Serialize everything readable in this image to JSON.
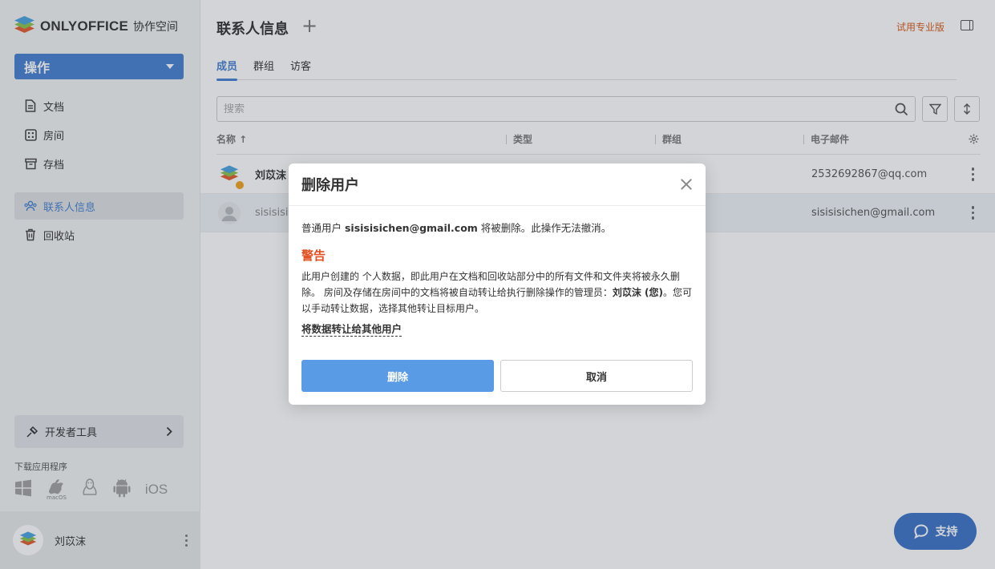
{
  "brand": {
    "name": "ONLYOFFICE",
    "subtitle": "协作空间"
  },
  "sidebar": {
    "actions_label": "操作",
    "items": [
      {
        "label": "文档",
        "icon": "document-icon"
      },
      {
        "label": "房间",
        "icon": "rooms-icon"
      },
      {
        "label": "存档",
        "icon": "archive-icon"
      },
      {
        "label": "联系人信息",
        "icon": "contacts-icon",
        "active": true
      },
      {
        "label": "回收站",
        "icon": "trash-icon"
      }
    ],
    "dev_tools_label": "开发者工具",
    "download_title": "下载应用程序",
    "download_apps": {
      "macos_label": "macOS",
      "ios_label": "iOS"
    },
    "profile_name": "刘苡沫"
  },
  "header": {
    "title": "联系人信息",
    "trial_label": "试用专业版"
  },
  "tabs": [
    {
      "label": "成员",
      "active": true
    },
    {
      "label": "群组"
    },
    {
      "label": "访客"
    }
  ],
  "search": {
    "placeholder": "搜索"
  },
  "table": {
    "columns": [
      "名称 ↑",
      "类型",
      "群组",
      "电子邮件"
    ],
    "rows": [
      {
        "name": "刘苡沫",
        "email": "2532692867@qq.com"
      },
      {
        "name": "sisisisic",
        "email": "sisisisichen@gmail.com"
      }
    ]
  },
  "support_label": "支持",
  "modal": {
    "title": "删除用户",
    "line_prefix": "普通用户 ",
    "line_email": "sisisisichen@gmail.com",
    "line_suffix": " 将被删除。此操作无法撤消。",
    "warning_title": "警告",
    "warning_part1": "此用户创建的 个人数据，即此用户在文档和回收站部分中的所有文件和文件夹将被永久删除。 房间及存储在房间中的文档将被自动转让给执行删除操作的管理员：",
    "warning_admin": "刘苡沫 (您)",
    "warning_part2": "。您可以手动转让数据，选择其他转让目标用户。",
    "transfer_link": "将数据转让给其他用户",
    "delete_label": "删除",
    "cancel_label": "取消"
  },
  "colors": {
    "accent": "#4781d1",
    "warning": "#e24f20",
    "trial": "#d95c1a",
    "delete_button": "#5a9be6"
  }
}
